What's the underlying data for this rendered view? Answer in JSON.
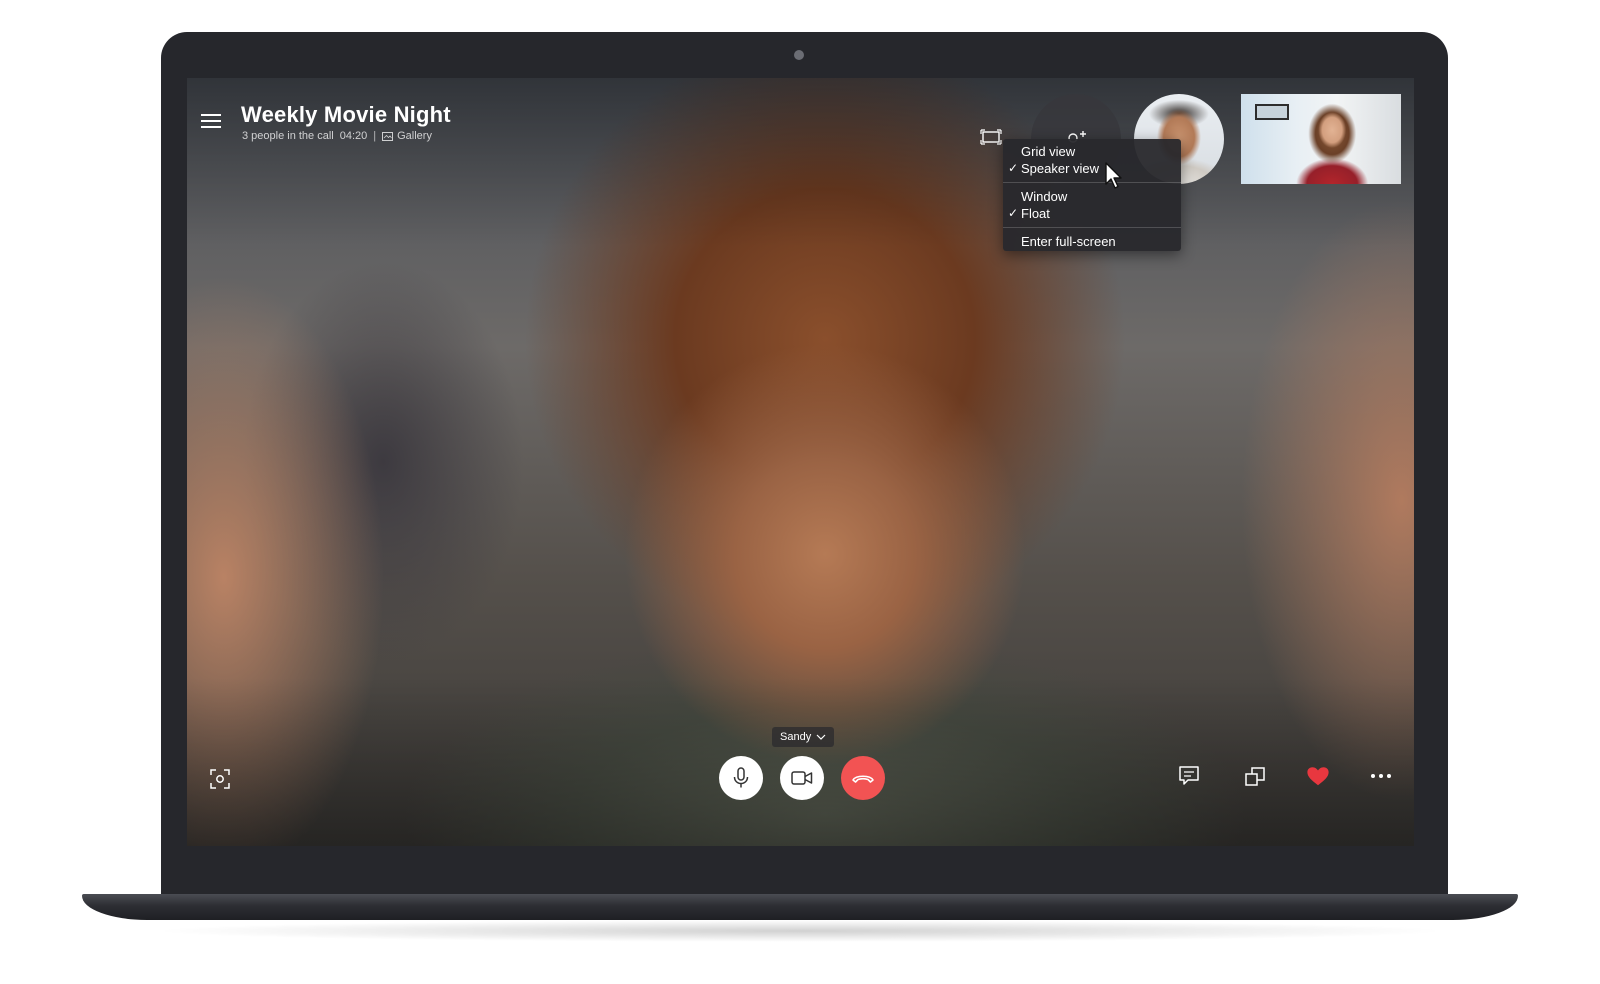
{
  "call": {
    "title": "Weekly Movie Night",
    "participants_text": "3 people in the call",
    "duration": "04:20",
    "separator": "|",
    "gallery_label": "Gallery"
  },
  "view_menu": {
    "items": [
      {
        "label": "Grid view",
        "checked": false
      },
      {
        "label": "Speaker view",
        "checked": true
      },
      {
        "label": "Window",
        "checked": false
      },
      {
        "label": "Float",
        "checked": true
      },
      {
        "label": "Enter full-screen",
        "checked": false
      }
    ],
    "check_glyph": "✓"
  },
  "speaker": {
    "name": "Sandy"
  },
  "controls": {
    "icons": [
      "menu-icon",
      "screenshot-icon",
      "microphone-icon",
      "video-camera-icon",
      "end-call-icon",
      "chat-icon",
      "switch-view-icon",
      "heart-icon",
      "more-icon",
      "layout-icon",
      "add-people-icon"
    ]
  },
  "colors": {
    "frame": "#26272c",
    "end_call": "#f25353",
    "heart": "#e8373f",
    "menu_bg": "#28282c"
  }
}
